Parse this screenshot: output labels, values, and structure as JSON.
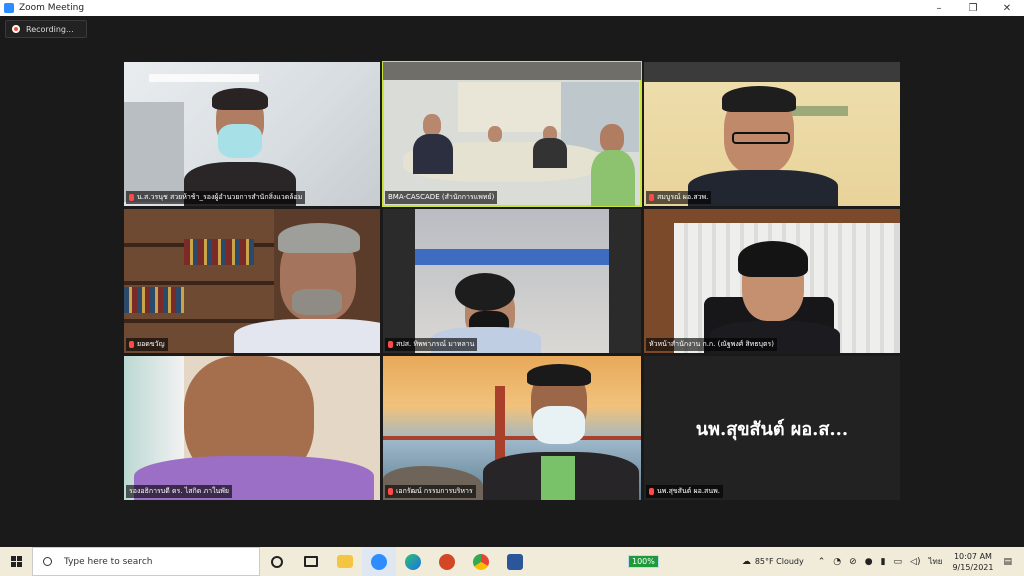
{
  "window": {
    "title": "Zoom Meeting",
    "controls": [
      "–",
      "❐",
      "✕"
    ]
  },
  "recording": {
    "label": "Recording..."
  },
  "participants": [
    {
      "name": "น.ส.วรนุช สวยห้าช้า_รองผู้อำนวยการสำนักสิ่งแวดล้อม",
      "muted": true
    },
    {
      "name": "BMA-CASCADE (สำนักการแพทย์)",
      "muted": false,
      "active": true
    },
    {
      "name": "สมบูรณ์ ผอ.สวพ.",
      "muted": true
    },
    {
      "name": "ยอดขวัญ",
      "muted": true
    },
    {
      "name": "สปส. ทิพพาภรณ์ มาหลาน",
      "muted": true
    },
    {
      "name": "หัวหน้าสำนักงาน ก.ก. (ณัฐพงศ์ สิทธบุตร)",
      "muted": true
    },
    {
      "name": "รองอธิการบดี ดร. ไสกิด ภาในพัย",
      "muted": true
    },
    {
      "name": "เอกรัฒน์ กรรมการบริหาร",
      "muted": true
    },
    {
      "name": "นพ.สุขสันต์ ผอ.สนพ.",
      "muted": true,
      "display": "นพ.สุขสันต์ ผอ.ส..."
    }
  ],
  "taskbar": {
    "search_placeholder": "Type here to search",
    "battery": "100%",
    "weather": "85°F  Cloudy",
    "language": "ไทย",
    "time": "10:07 AM",
    "date": "9/15/2021"
  }
}
